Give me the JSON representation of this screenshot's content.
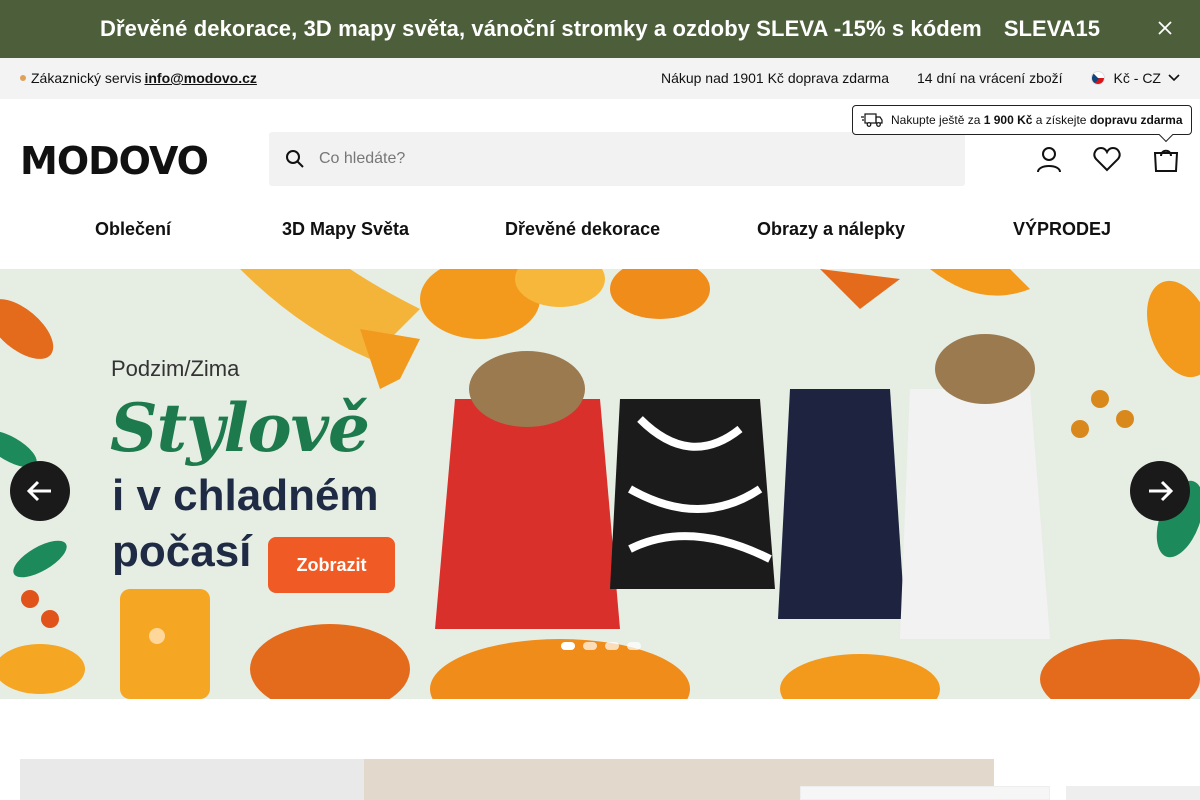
{
  "promo": {
    "text": "Dřevěné dekorace, 3D mapy světa, vánoční stromky a ozdoby SLEVA -15% s kódem",
    "code": "SLEVA15",
    "close_icon": "close-icon"
  },
  "infobar": {
    "service_label": "Zákaznický servis",
    "service_email": "info@modovo.cz",
    "shipping": "Nákup nad 1901 Kč doprava zdarma",
    "returns": "14 dní na vrácení zboží",
    "currency": "Kč - CZ"
  },
  "header": {
    "logo": "MODOVO",
    "search_placeholder": "Co hledáte?",
    "tooltip": {
      "prefix": "Nakupte ještě za",
      "amount": "1 900 Kč",
      "middle": "a získejte",
      "bold_end": "dopravu zdarma"
    }
  },
  "nav": {
    "items": [
      "Oblečení",
      "3D Mapy Světa",
      "Dřevěné dekorace",
      "Obrazy a nálepky",
      "VÝPRODEJ"
    ]
  },
  "hero": {
    "subtitle": "Podzim/Zima",
    "title": "Stylově",
    "line2": "i v chladném",
    "line3": "počasí",
    "button": "Zobrazit",
    "colors": {
      "green": "#1d7a4d",
      "navy": "#1f2a44",
      "orange": "#f05a24"
    },
    "slides_total": 4,
    "slide_active": 1
  }
}
